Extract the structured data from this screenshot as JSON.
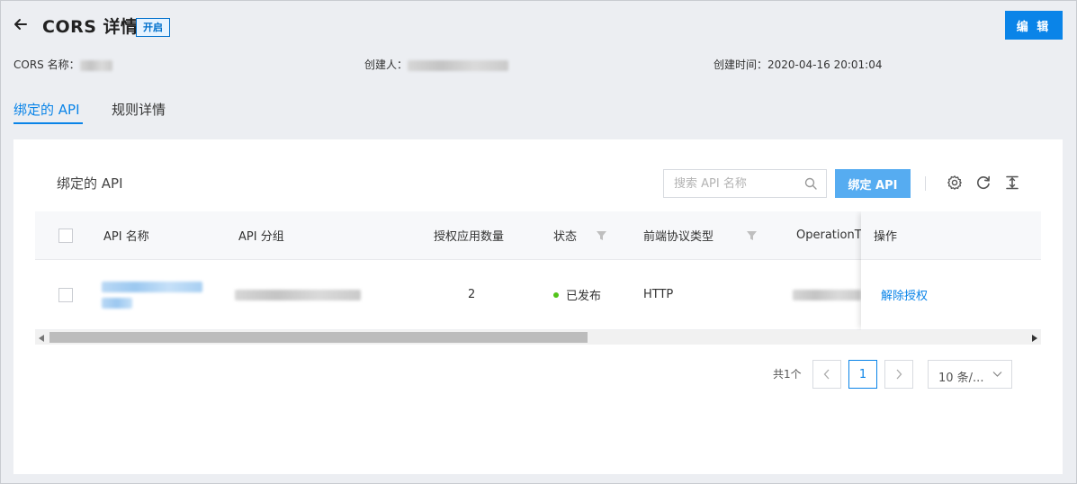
{
  "header": {
    "title": "CORS 详情",
    "status_tag": "开启",
    "edit_label": "编 辑"
  },
  "meta": {
    "cors_name_label": "CORS 名称：",
    "creator_label": "创建人：",
    "created_time_label": "创建时间：",
    "created_time_value": "2020-04-16 20:01:04"
  },
  "tabs": [
    {
      "label": "绑定的 API",
      "active": true
    },
    {
      "label": "规则详情",
      "active": false
    }
  ],
  "panel": {
    "title": "绑定的 API",
    "search_placeholder": "搜索 API 名称",
    "bind_button": "绑定 API"
  },
  "table": {
    "columns": [
      "API 名称",
      "API 分组",
      "授权应用数量",
      "状态",
      "前端协议类型",
      "OperationT",
      "操作"
    ],
    "rows": [
      {
        "auth_app_count": "2",
        "status": "已发布",
        "protocol": "HTTP",
        "action": "解除授权"
      }
    ]
  },
  "pagination": {
    "total": "共1个",
    "current_page": "1",
    "page_size": "10 条/..."
  },
  "colors": {
    "primary": "#0a84e8",
    "primary_light": "#56acf1",
    "status_green": "#52c41a"
  }
}
